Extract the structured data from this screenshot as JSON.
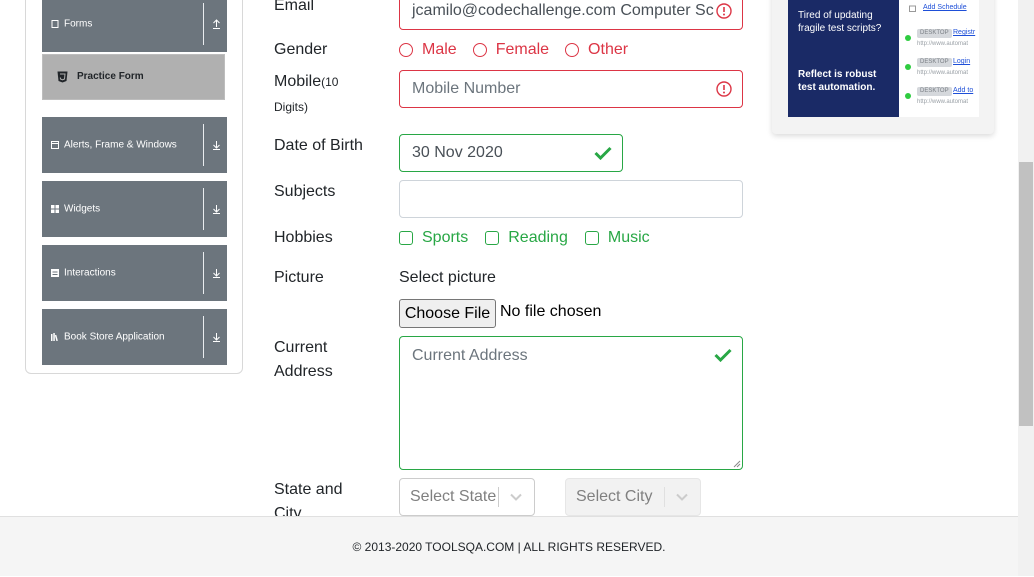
{
  "sidebar": {
    "groups": [
      {
        "label": "Forms",
        "icon": "file-icon",
        "arrow": "collapse-arrow-icon"
      },
      {
        "label": "Alerts, Frame & Windows",
        "icon": "window-icon",
        "arrow": "expand-arrow-icon"
      },
      {
        "label": "Widgets",
        "icon": "grid-icon",
        "arrow": "expand-arrow-icon"
      },
      {
        "label": "Interactions",
        "icon": "list-icon",
        "arrow": "expand-arrow-icon"
      },
      {
        "label": "Book Store Application",
        "icon": "books-icon",
        "arrow": "expand-arrow-icon"
      }
    ],
    "active_item": {
      "label": "Practice Form",
      "icon": "html5-icon"
    }
  },
  "form": {
    "email": {
      "label": "Email",
      "value": "jcamilo@codechallenge.com Computer Sc",
      "status": "invalid"
    },
    "gender": {
      "label": "Gender",
      "options": [
        "Male",
        "Female",
        "Other"
      ],
      "status": "invalid"
    },
    "mobile": {
      "label": "Mobile",
      "label_hint": "(10",
      "label_hint2": "Digits)",
      "placeholder": "Mobile Number",
      "status": "invalid"
    },
    "dob": {
      "label": "Date of Birth",
      "value": "30 Nov 2020",
      "status": "valid"
    },
    "subjects": {
      "label": "Subjects",
      "value": ""
    },
    "hobbies": {
      "label": "Hobbies",
      "options": [
        "Sports",
        "Reading",
        "Music"
      ],
      "status": "valid"
    },
    "picture": {
      "label": "Picture",
      "caption": "Select picture",
      "button": "Choose File",
      "file_status": "No file chosen"
    },
    "address": {
      "label": "Current",
      "label2": "Address",
      "placeholder": "Current Address",
      "status": "valid"
    },
    "state_city": {
      "label": "State and",
      "label2": "City",
      "state_placeholder": "Select State",
      "city_placeholder": "Select City"
    }
  },
  "ad": {
    "line1": "Tired of updating fragile test scripts?",
    "line2": "Reflect is robust test automation.",
    "rows": [
      {
        "badge": "",
        "link": "Add Schedule",
        "url": ""
      },
      {
        "badge": "DESKTOP",
        "link": "Registr",
        "url": "http://www.automat"
      },
      {
        "badge": "DESKTOP",
        "link": "Login",
        "url": "http://www.automat"
      },
      {
        "badge": "DESKTOP",
        "link": "Add to",
        "url": "http://www.automat"
      }
    ]
  },
  "footer": {
    "text": "© 2013-2020 TOOLSQA.COM | ALL RIGHTS RESERVED."
  },
  "colors": {
    "invalid": "#dc3545",
    "valid": "#28a745",
    "sidebar": "#6c757d",
    "active": "#b0b0b0"
  }
}
